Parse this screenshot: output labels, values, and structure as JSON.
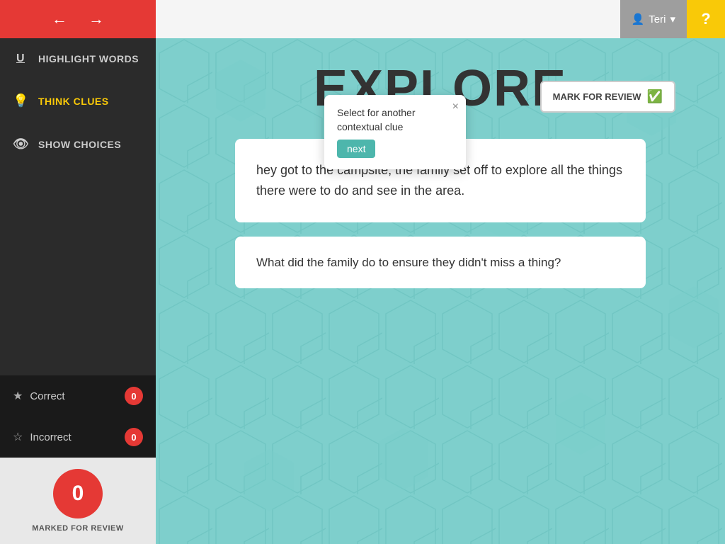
{
  "nav": {
    "back_label": "←",
    "forward_label": "→"
  },
  "user": {
    "name": "Teri",
    "dropdown_arrow": "▾"
  },
  "help": {
    "label": "?"
  },
  "sidebar": {
    "items": [
      {
        "id": "highlight-words",
        "label": "HIGHLIGHT WORDS",
        "icon": "U̲",
        "active": false
      },
      {
        "id": "think-clues",
        "label": "THINK CLUES",
        "icon": "💡",
        "active": true
      },
      {
        "id": "show-choices",
        "label": "SHOW CHOICES",
        "icon": "👁",
        "active": false
      }
    ],
    "correct_label": "Correct",
    "incorrect_label": "Incorrect",
    "correct_count": "0",
    "incorrect_count": "0",
    "review_count": "0",
    "marked_for_review_label": "MARKED FOR REVIEW"
  },
  "content": {
    "title": "EXPLORE",
    "mark_review_label": "MARK FOR REVIEW",
    "passage_text": "hey got to the campsite, the family set off to explore all the things there were to do and see in the area.",
    "question_text": "What did the family do to ensure they didn't miss a thing?"
  },
  "tooltip": {
    "text": "Select for another contextual clue",
    "next_label": "next",
    "close_label": "×"
  }
}
